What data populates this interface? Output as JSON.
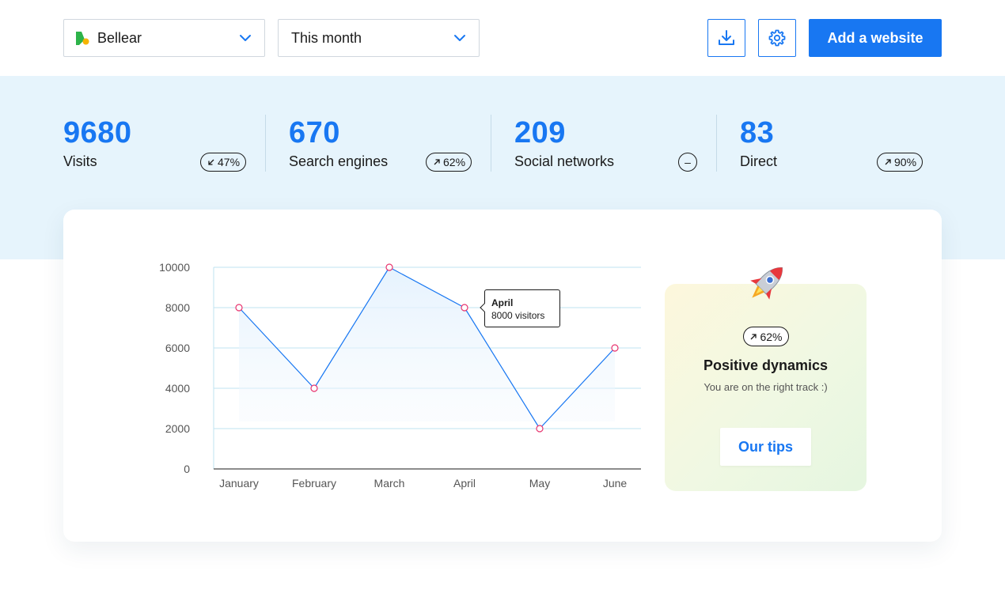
{
  "toolbar": {
    "site_select": "Bellear",
    "period_select": "This month",
    "add_website_label": "Add a website"
  },
  "stats": [
    {
      "value": "9680",
      "label": "Visits",
      "change": "47%",
      "direction": "down"
    },
    {
      "value": "670",
      "label": "Search engines",
      "change": "62%",
      "direction": "up"
    },
    {
      "value": "209",
      "label": "Social networks",
      "change": "–",
      "direction": "none"
    },
    {
      "value": "83",
      "label": "Direct",
      "change": "90%",
      "direction": "up"
    }
  ],
  "chart_data": {
    "type": "area",
    "categories": [
      "January",
      "February",
      "March",
      "April",
      "May",
      "June"
    ],
    "values": [
      8000,
      4000,
      10000,
      8000,
      2000,
      6000
    ],
    "ylim": [
      0,
      10000
    ],
    "yticks": [
      0,
      2000,
      4000,
      6000,
      8000,
      10000
    ],
    "grid": true,
    "tooltip": {
      "title": "April",
      "text": "8000 visitors"
    }
  },
  "tips": {
    "change": "62%",
    "title": "Positive dynamics",
    "subtitle": "You are on the right track :)",
    "button_label": "Our tips"
  },
  "colors": {
    "accent": "#1877f2",
    "band": "#e6f4fc",
    "marker": "#e8336e"
  }
}
